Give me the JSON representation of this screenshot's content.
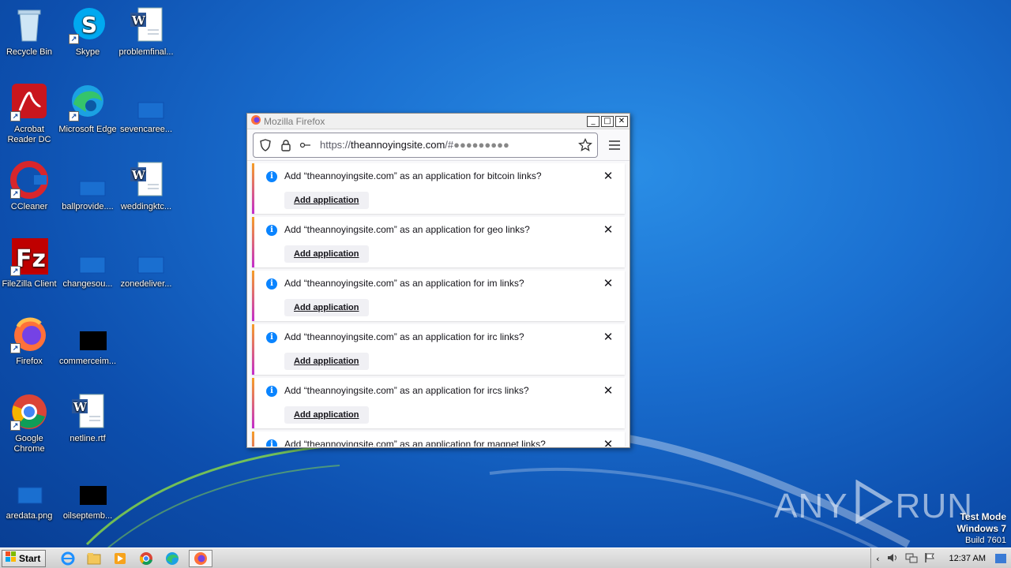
{
  "desktop": {
    "icons": [
      {
        "label": "Recycle Bin"
      },
      {
        "label": "Skype"
      },
      {
        "label": "problemfinal..."
      },
      {
        "label": "Acrobat Reader DC"
      },
      {
        "label": "Microsoft Edge"
      },
      {
        "label": "sevencaree..."
      },
      {
        "label": "CCleaner"
      },
      {
        "label": "ballprovide...."
      },
      {
        "label": "weddingktc..."
      },
      {
        "label": "FileZilla Client"
      },
      {
        "label": "changesou..."
      },
      {
        "label": "zonedeliver..."
      },
      {
        "label": "Firefox"
      },
      {
        "label": "commerceim..."
      },
      {
        "label": "Google Chrome"
      },
      {
        "label": "netline.rtf"
      },
      {
        "label": "aredata.png"
      },
      {
        "label": "oilseptemb..."
      }
    ]
  },
  "firefox": {
    "title": "Mozilla Firefox",
    "url_prefix": "https://",
    "url_host": "theannoyingsite.com",
    "url_rest": "/#",
    "notification_button_label": "Add application",
    "notifications": [
      {
        "message": "Add “theannoyingsite.com” as an application for bitcoin links?"
      },
      {
        "message": "Add “theannoyingsite.com” as an application for geo links?"
      },
      {
        "message": "Add “theannoyingsite.com” as an application for im links?"
      },
      {
        "message": "Add “theannoyingsite.com” as an application for irc links?"
      },
      {
        "message": "Add “theannoyingsite.com” as an application for ircs links?"
      },
      {
        "message": "Add “theannoyingsite.com” as an application for magnet links?"
      }
    ]
  },
  "taskbar": {
    "start_label": "Start",
    "clock": "12:37 AM"
  },
  "watermark": {
    "text_left": "ANY",
    "text_right": "RUN",
    "line1": "Test Mode",
    "line2": "Windows 7",
    "line3": "Build 7601"
  },
  "colors": {
    "accent": "#0a84ff",
    "notif_gradient_top": "#f6a023",
    "notif_gradient_bottom": "#c22bd0"
  }
}
